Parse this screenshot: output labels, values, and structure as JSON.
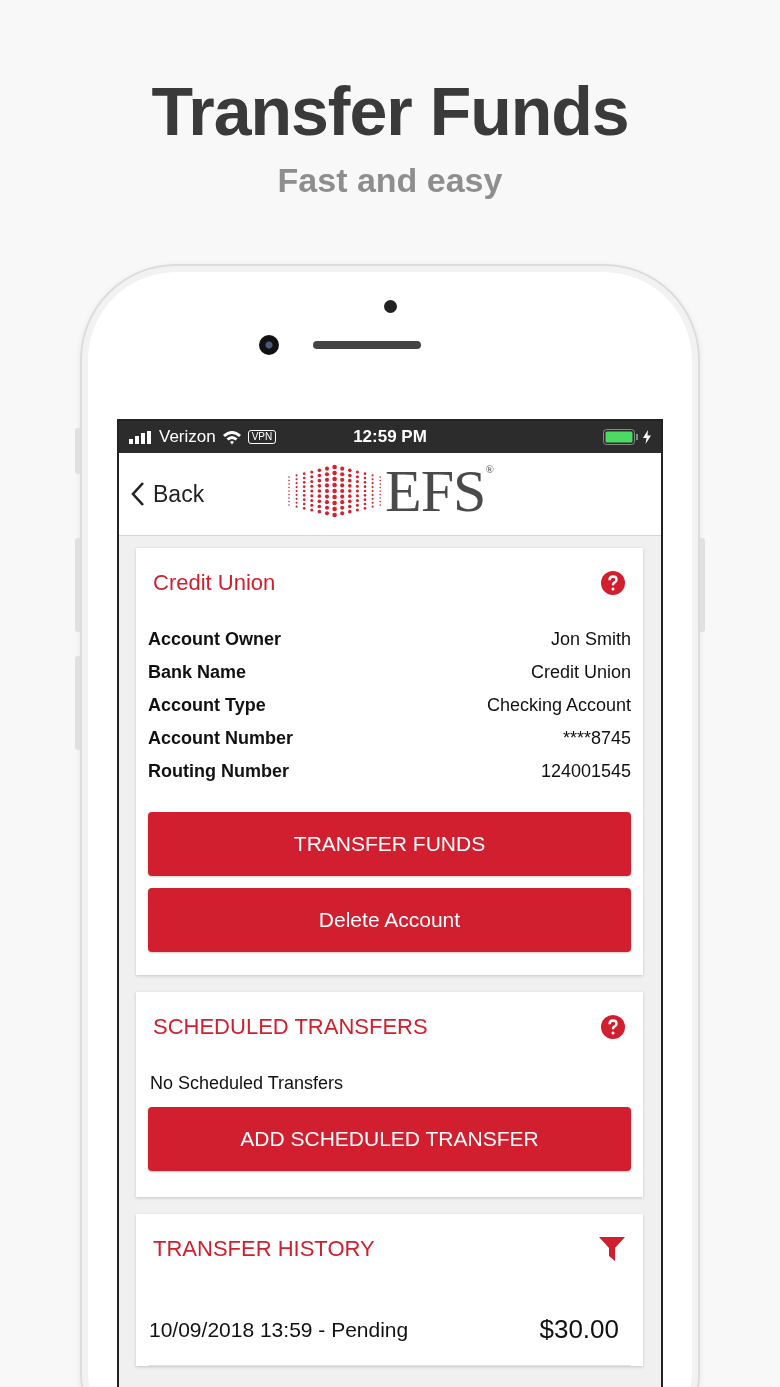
{
  "headline": {
    "title": "Transfer Funds",
    "subtitle": "Fast and easy"
  },
  "status_bar": {
    "carrier": "Verizon",
    "vpn": "VPN",
    "time": "12:59 PM"
  },
  "nav": {
    "back": "Back",
    "logo": "EFS",
    "logo_mark": "®"
  },
  "account_card": {
    "title": "Credit Union",
    "rows": [
      {
        "label": "Account Owner",
        "value": "Jon Smith"
      },
      {
        "label": "Bank Name",
        "value": "Credit Union"
      },
      {
        "label": "Account Type",
        "value": "Checking Account"
      },
      {
        "label": "Account Number",
        "value": "****8745"
      },
      {
        "label": "Routing Number",
        "value": "124001545"
      }
    ],
    "buttons": [
      "TRANSFER FUNDS",
      "Delete Account"
    ]
  },
  "scheduled_card": {
    "title": "SCHEDULED TRANSFERS",
    "empty_text": "No Scheduled Transfers",
    "button": "ADD SCHEDULED TRANSFER"
  },
  "history_card": {
    "title": "TRANSFER HISTORY",
    "items": [
      {
        "description": "10/09/2018 13:59 - Pending",
        "amount": "$30.00"
      }
    ]
  }
}
